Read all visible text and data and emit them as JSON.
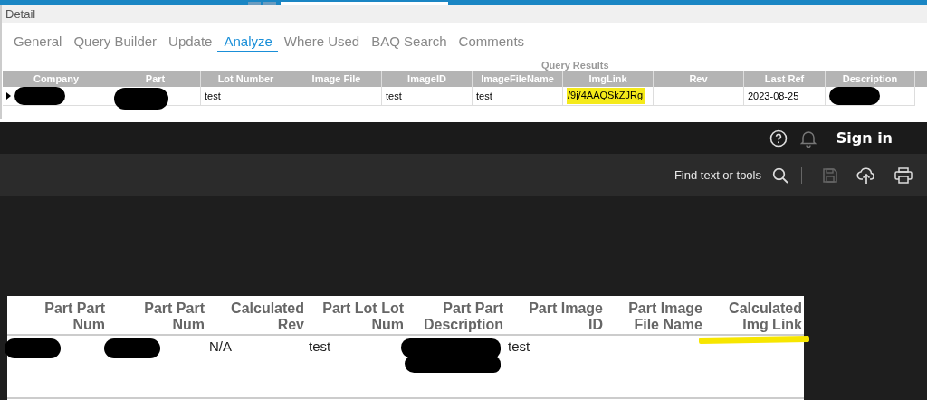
{
  "panel": {
    "title": "Detail"
  },
  "tabs": [
    {
      "label": "General",
      "selected": false
    },
    {
      "label": "Query Builder",
      "selected": false
    },
    {
      "label": "Update",
      "selected": false
    },
    {
      "label": "Analyze",
      "selected": true
    },
    {
      "label": "Where Used",
      "selected": false
    },
    {
      "label": "BAQ Search",
      "selected": false
    },
    {
      "label": "Comments",
      "selected": false
    }
  ],
  "query_results": {
    "title": "Query Results",
    "columns": [
      "Company",
      "Part",
      "Lot Number",
      "Image File",
      "ImageID",
      "ImageFileName",
      "ImgLink",
      "Rev",
      "Last Ref",
      "Description"
    ],
    "rows": [
      {
        "selected": true,
        "cells": [
          {
            "redacted": true
          },
          {
            "redacted": true
          },
          {
            "text": "test"
          },
          {},
          {
            "text": "test"
          },
          {
            "text": "test"
          },
          {
            "text": "/9j/4AAQSkZJRg",
            "highlighted": true
          },
          {},
          {
            "text": "2023-08-25"
          },
          {
            "redacted": true
          }
        ]
      }
    ]
  },
  "viewer": {
    "header": {
      "sign_in": "Sign in"
    },
    "toolbar": {
      "search_label": "Find text or tools",
      "tools": [
        {
          "kind": "save",
          "disabled": true
        },
        {
          "kind": "upload",
          "disabled": false
        },
        {
          "kind": "print",
          "disabled": false
        }
      ]
    },
    "table": {
      "columns": [
        {
          "label": "Part Part Num",
          "highlighted": false
        },
        {
          "label": "Part Part Num",
          "highlighted": false
        },
        {
          "label": "Calculated Rev",
          "highlighted": false
        },
        {
          "label": "Part Lot Lot Num",
          "highlighted": false
        },
        {
          "label": "Part Part Description",
          "highlighted": false
        },
        {
          "label": "Part Image ID",
          "highlighted": false
        },
        {
          "label": "Part Image File Name",
          "highlighted": false
        },
        {
          "label": "Calculated Img Link",
          "highlighted": true
        }
      ],
      "rows": [
        {
          "cells": [
            {
              "redacted": true
            },
            {
              "redacted": true
            },
            {
              "text": "N/A"
            },
            {
              "text": "test"
            },
            {
              "redacted": true
            },
            {
              "text": "test"
            },
            {},
            {}
          ]
        }
      ]
    }
  }
}
